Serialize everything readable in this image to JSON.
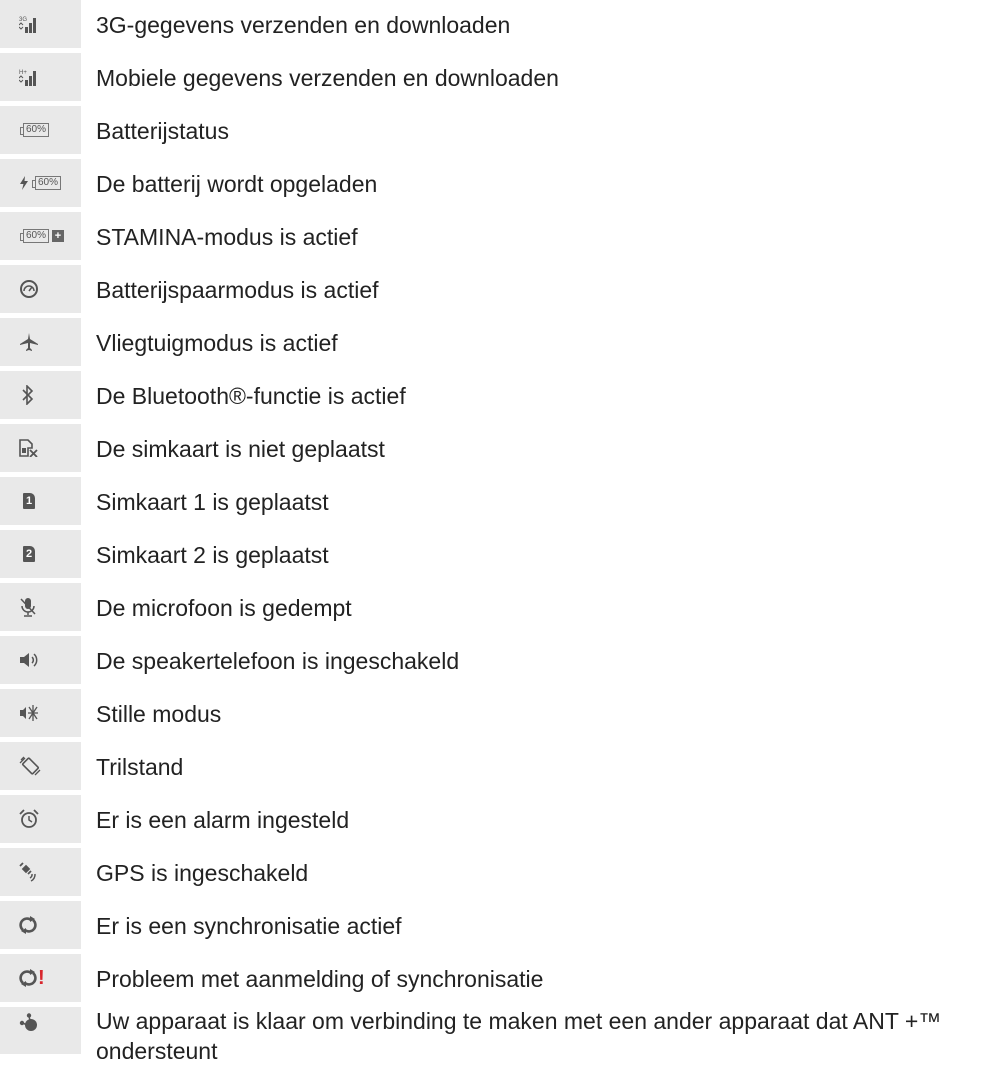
{
  "rows": [
    {
      "icon": "3g-signal-icon",
      "label": "3G-gegevens verzenden en downloaden"
    },
    {
      "icon": "hplus-signal-icon",
      "label": "Mobiele gegevens verzenden en downloaden"
    },
    {
      "icon": "battery-icon",
      "badge": "60%",
      "label": "Batterijstatus"
    },
    {
      "icon": "battery-charging-icon",
      "badge": "60%",
      "label": "De batterij wordt opgeladen"
    },
    {
      "icon": "stamina-battery-icon",
      "badge": "60%",
      "badge2": "+",
      "label": "STAMINA-modus is actief"
    },
    {
      "icon": "battery-saver-icon",
      "label": "Batterijspaarmodus is actief"
    },
    {
      "icon": "airplane-icon",
      "label": "Vliegtuigmodus is actief"
    },
    {
      "icon": "bluetooth-icon",
      "label": "De Bluetooth®-functie is actief"
    },
    {
      "icon": "no-sim-icon",
      "label": "De simkaart is niet geplaatst"
    },
    {
      "icon": "sim1-icon",
      "badge": "1",
      "label": "Simkaart 1 is geplaatst"
    },
    {
      "icon": "sim2-icon",
      "badge": "2",
      "label": "Simkaart 2 is geplaatst"
    },
    {
      "icon": "mic-muted-icon",
      "label": "De microfoon is gedempt"
    },
    {
      "icon": "speaker-icon",
      "label": "De speakertelefoon is ingeschakeld"
    },
    {
      "icon": "silent-icon",
      "label": "Stille modus"
    },
    {
      "icon": "vibrate-icon",
      "label": "Trilstand"
    },
    {
      "icon": "alarm-icon",
      "label": "Er is een alarm ingesteld"
    },
    {
      "icon": "gps-icon",
      "label": "GPS is ingeschakeld"
    },
    {
      "icon": "sync-icon",
      "label": "Er is een synchronisatie actief"
    },
    {
      "icon": "sync-error-icon",
      "badge": "!",
      "label": "Probleem met aanmelding of synchronisatie"
    },
    {
      "icon": "ant-plus-icon",
      "label": "Uw apparaat is klaar om verbinding te maken met een ander apparaat dat ANT +™ ondersteunt"
    }
  ]
}
